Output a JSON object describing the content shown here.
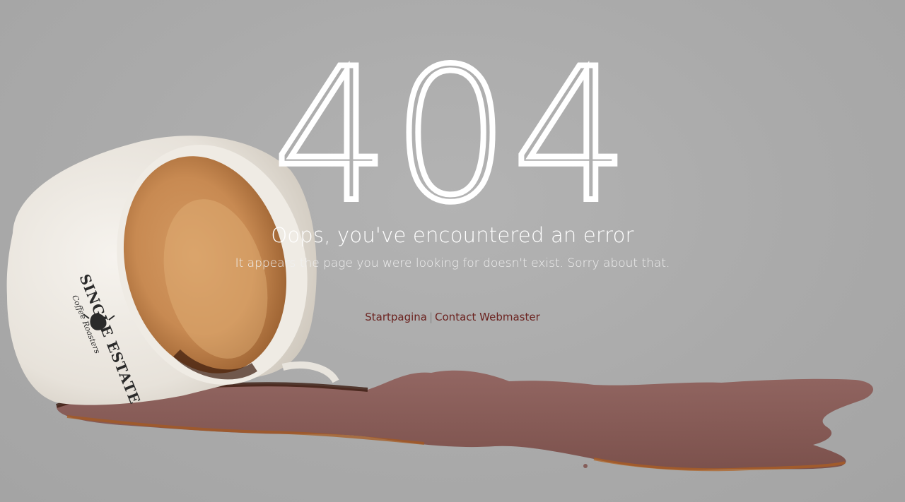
{
  "error": {
    "code": "404",
    "title": "Oops, you've encountered an error",
    "message": "It appears the page you were looking for doesn't exist. Sorry about that."
  },
  "links": {
    "home_label": "Startpagina",
    "separator": "|",
    "contact_label": "Contact Webmaster"
  },
  "cup": {
    "brand_name": "SINGLE ESTATE",
    "brand_tagline": "Coffee Roasters"
  },
  "colors": {
    "background": "#ababab",
    "text": "#ffffff",
    "link": "#6b2320",
    "coffee": "#7a4a45"
  }
}
